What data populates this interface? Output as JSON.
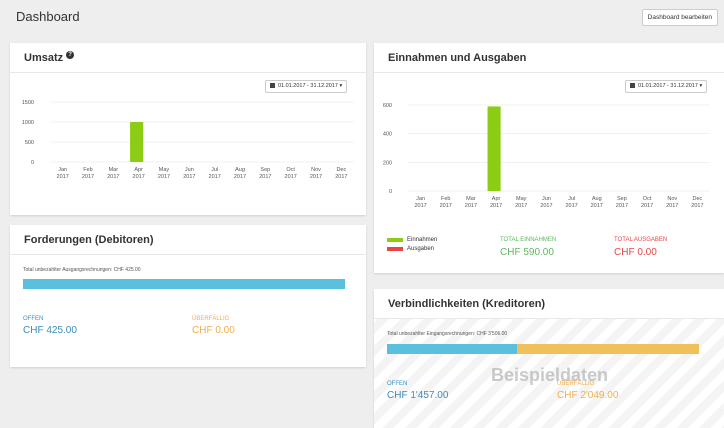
{
  "header": {
    "title": "Dashboard",
    "edit_label": "Dashboard bearbeiten"
  },
  "umsatz": {
    "title": "Umsatz",
    "date_range": "01.01.2017 - 31.12.2017",
    "chart_data": {
      "type": "bar",
      "categories": [
        "Jan 2017",
        "Feb 2017",
        "Mar 2017",
        "Apr 2017",
        "May 2017",
        "Jun 2017",
        "Jul 2017",
        "Aug 2017",
        "Sep 2017",
        "Oct 2017",
        "Nov 2017",
        "Dec 2017"
      ],
      "values": [
        0,
        0,
        0,
        1000,
        0,
        0,
        0,
        0,
        0,
        0,
        0,
        0
      ],
      "yticks": [
        "0",
        "500",
        "1000",
        "1500"
      ],
      "ylim": [
        0,
        1500
      ],
      "color": "#8ccc14",
      "grid": true
    }
  },
  "einnahmen": {
    "title": "Einnahmen und Ausgaben",
    "date_range": "01.01.2017 - 31.12.2017",
    "chart_data": {
      "type": "bar",
      "categories": [
        "Jan 2017",
        "Feb 2017",
        "Mar 2017",
        "Apr 2017",
        "May 2017",
        "Jun 2017",
        "Jul 2017",
        "Aug 2017",
        "Sep 2017",
        "Oct 2017",
        "Nov 2017",
        "Dec 2017"
      ],
      "series": [
        {
          "name": "Einnahmen",
          "values": [
            0,
            0,
            0,
            590,
            0,
            0,
            0,
            0,
            0,
            0,
            0,
            0
          ],
          "color": "#8ccc14"
        },
        {
          "name": "Ausgaben",
          "values": [
            0,
            0,
            0,
            0,
            0,
            0,
            0,
            0,
            0,
            0,
            0,
            0
          ],
          "color": "#e8454a"
        }
      ],
      "yticks": [
        "0",
        "200",
        "400",
        "600"
      ],
      "ylim": [
        0,
        600
      ],
      "grid": true
    },
    "legend": [
      {
        "label": "Einnahmen",
        "color": "#8ccc14"
      },
      {
        "label": "Ausgaben",
        "color": "#e8454a"
      }
    ],
    "total_in_label": "TOTAL EINNAHMEN",
    "total_in_value": "CHF 590.00",
    "total_out_label": "TOTAL AUSGABEN",
    "total_out_value": "CHF 0.00"
  },
  "forderungen": {
    "title": "Forderungen (Debitoren)",
    "subtitle": "Total unbezahlter Ausgangsrechnungen: CHF 425.00",
    "progress": {
      "open_fraction": 1.0,
      "overdue_fraction": 0.0
    },
    "open_label": "OFFEN",
    "open_value": "CHF 425.00",
    "overdue_label": "ÜBERFÄLLIG",
    "overdue_value": "CHF 0.00"
  },
  "verbindlichkeiten": {
    "title": "Verbindlichkeiten (Kreditoren)",
    "subtitle": "Total unbezahlter Eingangsrechnungen: CHF 3'506.00",
    "progress": {
      "open_fraction": 0.4156,
      "overdue_fraction": 0.5844
    },
    "open_label": "OFFEN",
    "open_value": "CHF 1'457.00",
    "overdue_label": "ÜBERFÄLLIG",
    "overdue_value": "CHF 2'049.00",
    "watermark": "Beispieldaten"
  },
  "colors": {
    "green": "#8ccc14",
    "red": "#e8454a",
    "blue": "#5bc0de",
    "orange": "#f0ad4e"
  }
}
